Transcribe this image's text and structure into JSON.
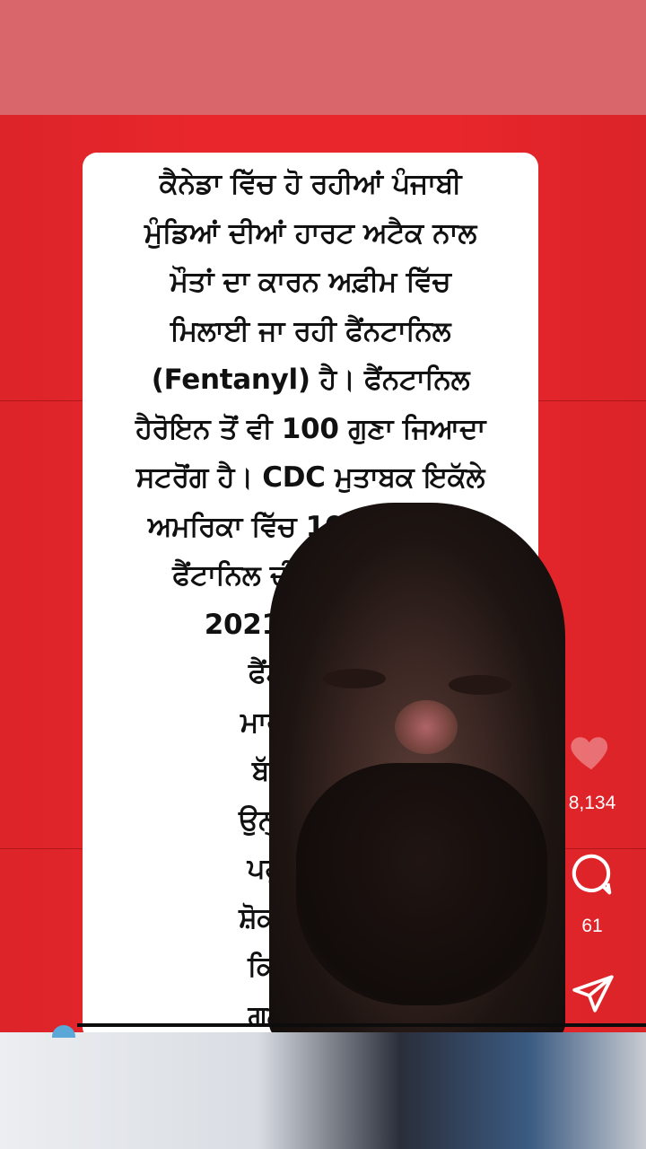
{
  "post": {
    "caption_lines": [
      "ਕੈਨੇਡਾ ਵਿੱਚ ਹੋ ਰਹੀਆਂ ਪੰਜਾਬੀ",
      "ਮੁੰਡਿਆਂ ਦੀਆਂ ਹਾਰਟ ਅਟੈਕ ਨਾਲ",
      "ਮੌਤਾਂ ਦਾ ਕਾਰਨ ਅਫ਼ੀਮ ਵਿੱਚ",
      "ਮਿਲਾਈ ਜਾ ਰਹੀ ਫੈਂਨਟਾਨਿਲ",
      "(Fentanyl) ਹੈ। ਫੈਂਨਟਾਨਿਲ",
      "ਹੈਰੋਇਨ ਤੋਂ ਵੀ 100 ਗੁਣਾ ਜਿਆਦਾ",
      "ਸਟਰੋਂਗ ਹੈ। CDC ਮੁਤਾਬਕ ਇਕੱਲੇ",
      "ਅਮਰਿਕਾ ਵਿੱਚ 107375 ਮੌਤਾਂ",
      "ਫੈਂਟਾਨਿਲ ਦੀ ਓਵਰਡੋਜ਼ ਨਾਲ",
      "2021 ਵਿੱਚ ਹੋਈਆਂ",
      "ਫੈਂਟਾਨਿਲ ਦੀ",
      "ਮਾਰਨ ਲਈ ਬ",
      "ਬੱਚੇ ਜਾਂ ਦੋਸ",
      "ਉਨ੍ਹਾਂ ਤੱਕ ਜਿ",
      "ਪਹੁੰਚਾਓ। ਜੋ",
      "ਸ਼ੋਕੀਨ ਹਨ, ਜ",
      "ਕਿਉਂਕਿ ਇਹ",
      "ਗਲਤੀ ਵੀ ਹੋ"
    ]
  },
  "actions": {
    "likes_count": "8,134",
    "comments_count": "61",
    "heart_icon": "heart-icon",
    "comment_icon": "comment-icon",
    "share_icon": "send-icon"
  },
  "colors": {
    "background_red": "#e8262b",
    "top_strip": "#d9666b",
    "card": "#ffffff",
    "progress_accent": "#5aa7d8"
  }
}
